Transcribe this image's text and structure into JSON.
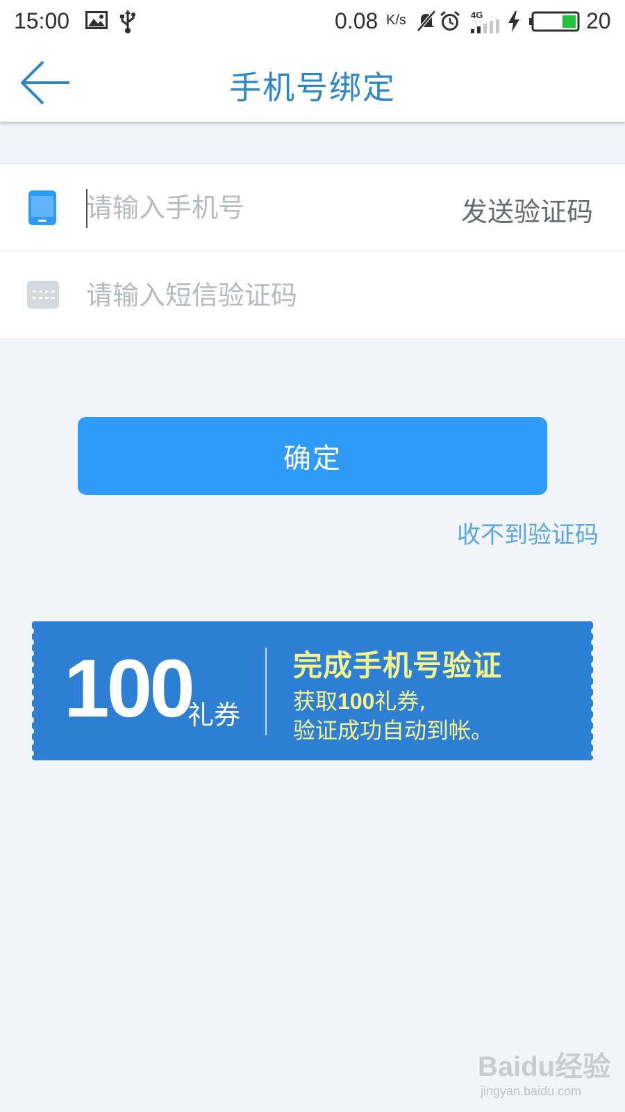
{
  "status_bar": {
    "time": "15:00",
    "network_speed": "0.08",
    "speed_unit": "K/s",
    "network_type": "4G",
    "battery_level": "20",
    "icons": [
      "image-icon",
      "usb-icon",
      "mute-icon",
      "alarm-icon",
      "signal-icon",
      "charging-icon",
      "battery-icon"
    ]
  },
  "app_bar": {
    "title": "手机号绑定",
    "back_icon": "arrow-left-icon"
  },
  "form": {
    "phone": {
      "placeholder": "请输入手机号",
      "value": "",
      "icon": "phone-icon",
      "send_code_label": "发送验证码"
    },
    "sms_code": {
      "placeholder": "请输入短信验证码",
      "value": "",
      "icon": "keyboard-icon"
    }
  },
  "actions": {
    "confirm_label": "确定",
    "no_code_label": "收不到验证码"
  },
  "coupon": {
    "amount": "100",
    "unit": "礼券",
    "title": "完成手机号验证",
    "desc_prefix": "获取",
    "desc_amount": "100",
    "desc_suffix": "礼券,",
    "desc_line2": "验证成功自动到帐。"
  },
  "watermark": {
    "logo": "Baidu经验",
    "url": "jingyan.baidu.com"
  },
  "colors": {
    "accent": "#2e9bf8",
    "title_blue": "#2d86c8",
    "coupon_blue": "#2c7fd3",
    "coupon_text": "#f6f28c",
    "background": "#f1f4f9"
  }
}
